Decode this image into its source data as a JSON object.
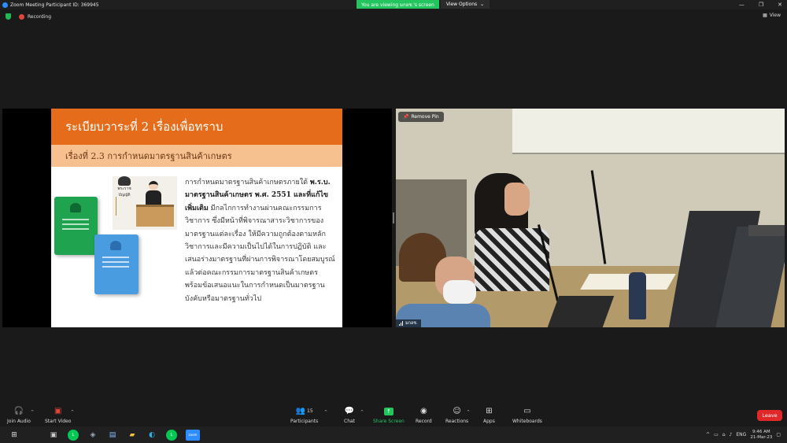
{
  "window": {
    "title": "Zoom Meeting Participant ID: 369945",
    "viewing_banner": "You are viewing มกอช.'s screen",
    "view_options": "View Options"
  },
  "status": {
    "recording": "Recording",
    "view": "View"
  },
  "slide": {
    "heading": "ระเบียบวาระที่ 2   เรื่องเพื่อทราบ",
    "subheading": "เรื่องที่ 2.3   การกำหนดมาตรฐานสินค้าเกษตร",
    "body_intro": "การกำหนดมาตรฐานสินค้าเกษตรภายใต้ ",
    "body_bold": "พ.ร.บ. มาตรฐานสินค้าเกษตร พ.ศ. 2551 และที่แก้ไขเพิ่มเติม",
    "body_rest": " มีกลไกการทำงานผ่านคณะกรรมการวิชาการ ซึ่งมีหน้าที่พิจารณาสาระวิชาการของมาตรฐานแต่ละเรื่อง ให้มีความถูกต้องตามหลักวิชาการและมีความเป็นไปได้ในการปฏิบัติ และเสนอร่างมาตรฐานที่ผ่านการพิจารณาโดยสมบูรณ์แล้วต่อคณะกรรมการมาตรฐานสินค้าเกษตร พร้อมข้อเสนอแนะในการกำหนดเป็นมาตรฐานบังคับหรือมาตรฐานทั่วไป",
    "emblem_caption": "พระราชบัญญัติ"
  },
  "video": {
    "remove_pin": "Remove Pin",
    "participant_name": "มกอช."
  },
  "toolbar": {
    "join_audio": "Join Audio",
    "start_video": "Start Video",
    "participants": "Participants",
    "participants_count": "15",
    "chat": "Chat",
    "share_screen": "Share Screen",
    "record": "Record",
    "reactions": "Reactions",
    "apps": "Apps",
    "whiteboards": "Whiteboards",
    "leave": "Leave"
  },
  "taskbar": {
    "language": "ENG",
    "time": "9:46 AM",
    "date": "21-Mar-23"
  },
  "colors": {
    "accent_green": "#23c55e",
    "slide_orange": "#e46c1a",
    "slide_peach": "#f6c08f",
    "leave_red": "#e02828"
  }
}
